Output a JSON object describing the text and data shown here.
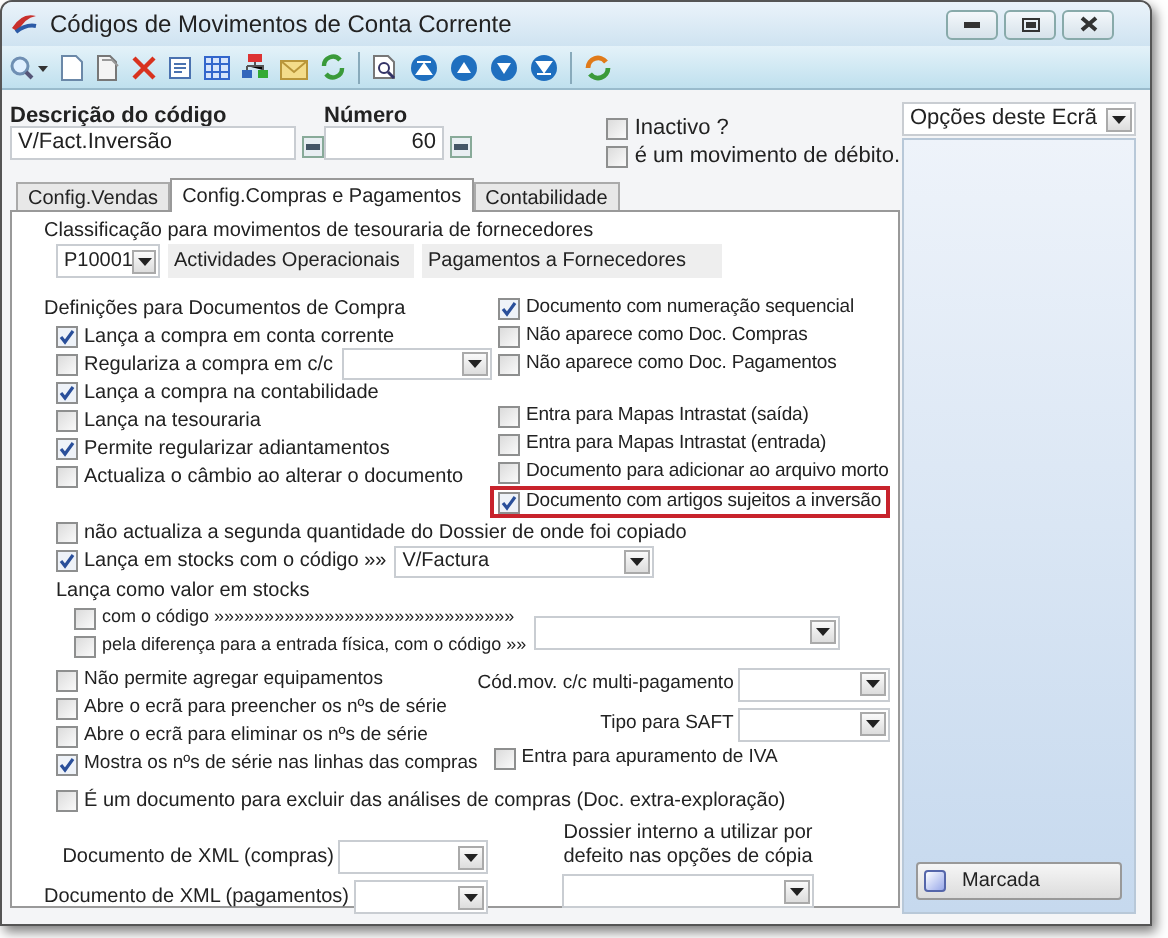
{
  "window": {
    "title": "Códigos de Movimentos de Conta Corrente"
  },
  "description": {
    "label": "Descrição do código",
    "value": "V/Fact.Inversão"
  },
  "number": {
    "label": "Número",
    "value": "60"
  },
  "flags": [
    {
      "label": "Inactivo ?",
      "checked": false
    },
    {
      "label": "é um movimento de débito.",
      "checked": false
    }
  ],
  "tabs": [
    {
      "label": "Config.Vendas",
      "selected": false
    },
    {
      "label": "Config.Compras e Pagamentos",
      "selected": true
    },
    {
      "label": "Contabilidade",
      "selected": false
    }
  ],
  "classification": {
    "label": "Classificação para movimentos de tesouraria de fornecedores",
    "code": "P10001",
    "field_2": "Actividades Operacionais",
    "field_3": "Pagamentos a Fornecedores"
  },
  "purchase_definitions": {
    "title": "Definições para Documentos de Compra",
    "left": [
      {
        "label": "Lança a compra em conta corrente",
        "checked": true,
        "kind": "checkbox"
      },
      {
        "label": "Regulariza a compra em c/c",
        "checked": false,
        "kind": "checkbox_dropdown"
      },
      {
        "label": "Lança a compra na contabilidade",
        "checked": true,
        "kind": "checkbox"
      },
      {
        "label": "Lança na tesouraria",
        "checked": false,
        "kind": "checkbox"
      },
      {
        "label": "Permite regularizar adiantamentos",
        "checked": true,
        "kind": "checkbox"
      },
      {
        "label": "Actualiza o câmbio ao alterar o documento",
        "checked": false,
        "kind": "checkbox"
      }
    ],
    "right_top": [
      {
        "label": "Documento com numeração sequencial",
        "checked": true,
        "highlighted": false
      },
      {
        "label": "Não aparece como Doc. Compras",
        "checked": false,
        "highlighted": false
      },
      {
        "label": "Não aparece como Doc. Pagamentos",
        "checked": false,
        "highlighted": false
      }
    ],
    "right_bottom": [
      {
        "label": "Entra para Mapas Intrastat (saída)",
        "checked": false,
        "highlighted": false
      },
      {
        "label": "Entra para Mapas Intrastat (entrada)",
        "checked": false,
        "highlighted": false
      },
      {
        "label": "Documento para adicionar ao arquivo morto",
        "checked": false,
        "highlighted": false
      },
      {
        "label": "Documento com artigos sujeitos a inversão",
        "checked": true,
        "highlighted": true
      }
    ]
  },
  "stock": {
    "no_update": {
      "label": "não actualiza a segunda quantidade do Dossier de onde foi copiado",
      "checked": false
    },
    "launch": {
      "label": "Lança em stocks com o código »»",
      "checked": true,
      "value": "V/Factura"
    },
    "value_title": "Lança como valor em stocks",
    "with_code": {
      "label": "com o código »»»»»»»»»»»»»»»»»»»»»»»»»»»»»»",
      "checked": false
    },
    "by_difference": {
      "label": "pela diferença para a entrada física, com o código »»",
      "checked": false
    }
  },
  "serials": [
    {
      "label": "Não permite agregar equipamentos",
      "checked": false
    },
    {
      "label": "Abre o ecrã para preencher os nºs de série",
      "checked": false
    },
    {
      "label": "Abre o ecrã para eliminar os nºs de série",
      "checked": false
    },
    {
      "label": "Mostra os nºs de série nas linhas das compras",
      "checked": true
    }
  ],
  "multi_payment_label": "Cód.mov. c/c multi-pagamento",
  "saft_label": "Tipo para SAFT",
  "vat": {
    "label": "Entra para apuramento de IVA",
    "checked": false
  },
  "exclude": {
    "label": "É um documento para excluir das análises de compras (Doc. extra-exploração)",
    "checked": false
  },
  "xml_purchases_label": "Documento de XML (compras)",
  "xml_payments_label": "Documento de XML (pagamentos)",
  "dossier_label": "Dossier interno a utilizar por defeito nas opções de cópia",
  "side_panel": {
    "dropdown": "Opções deste Ecrã",
    "button": "Marcada"
  }
}
